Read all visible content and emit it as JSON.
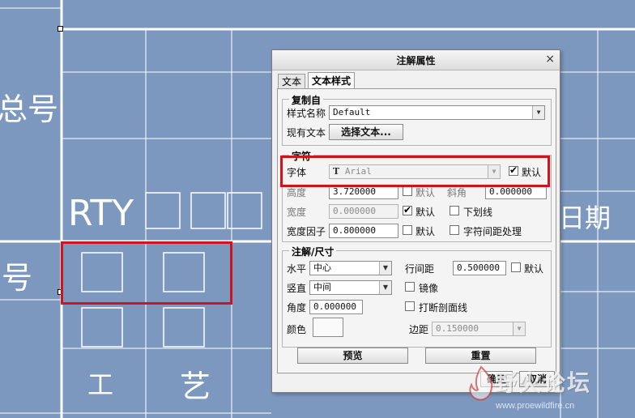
{
  "background": {
    "color": "#7c98bf",
    "line_color": "#ffffff",
    "labels": {
      "top_left": "总号",
      "mid_left": "号",
      "rty": "RTY",
      "right_date": "日期",
      "craft_1": "工",
      "craft_2": "艺"
    }
  },
  "dialog": {
    "title": "注解属性",
    "close_glyph": "×",
    "tabs": [
      "文本",
      "文本样式"
    ],
    "copy_from": {
      "title": "复制自",
      "style_name_label": "样式名称",
      "style_name_value": "Default",
      "existing_text_label": "现有文本",
      "select_text_button": "选择文本..."
    },
    "character": {
      "title": "字符",
      "font_label": "字体",
      "font_icon_glyph": "T",
      "font_value": "Arial",
      "font_default_label": "默认",
      "font_default_checked": true,
      "height_label": "高度",
      "height_value": "3.720000",
      "height_default_label": "默认",
      "height_default_checked": false,
      "slant_label": "斜角",
      "slant_value": "0.000000",
      "thickness_label": "宽度",
      "thickness_value": "0.000000",
      "thickness_default_label": "默认",
      "thickness_default_checked": true,
      "underline_label": "下划线",
      "underline_checked": false,
      "width_factor_label": "宽度因子",
      "width_factor_value": "0.800000",
      "width_factor_default_label": "默认",
      "width_factor_default_checked": false,
      "kerning_label": "字符间距处理",
      "kerning_checked": false
    },
    "note_dimension": {
      "title": "注解/尺寸",
      "horizontal_label": "水平",
      "horizontal_value": "中心",
      "line_spacing_label": "行间距",
      "line_spacing_value": "0.500000",
      "line_spacing_default_label": "默认",
      "line_spacing_default_checked": false,
      "vertical_label": "竖直",
      "vertical_value": "中间",
      "mirror_label": "镜像",
      "mirror_checked": false,
      "angle_label": "角度",
      "angle_value": "0.000000",
      "break_hatch_label": "打断剖面线",
      "break_hatch_checked": false,
      "color_label": "颜色",
      "margin_label": "边距",
      "margin_value": "0.150000"
    },
    "preview_button": "预览",
    "reset_button": "重置",
    "ok_button": "确定",
    "cancel_button": "取消"
  },
  "watermark": {
    "name": "野火论坛",
    "url": "www.proewildfire.cn"
  },
  "highlight_color": "#d0141c"
}
